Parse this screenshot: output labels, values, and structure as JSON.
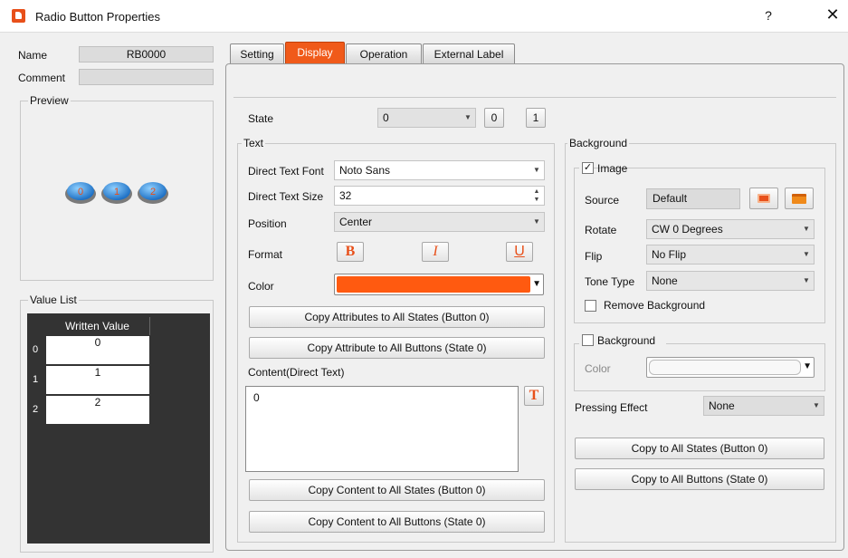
{
  "window": {
    "title": "Radio Button Properties",
    "help": "?",
    "close": "✕"
  },
  "left": {
    "name_label": "Name",
    "name_value": "RB0000",
    "comment_label": "Comment",
    "comment_value": "",
    "preview_label": "Preview",
    "preview_buttons": [
      "0",
      "1",
      "2"
    ],
    "value_list_label": "Value List",
    "table_header": "Written Value",
    "rows": [
      {
        "index": "0",
        "value": "0"
      },
      {
        "index": "1",
        "value": "1"
      },
      {
        "index": "2",
        "value": "2"
      }
    ]
  },
  "tabs": [
    "Setting",
    "Display",
    "Operation",
    "External Label"
  ],
  "active_tab": "Display",
  "display": {
    "state_label": "State",
    "state_value": "0",
    "state_btn0": "0",
    "state_btn1": "1",
    "text_group": "Text",
    "font_label": "Direct Text Font",
    "font_value": "Noto Sans",
    "size_label": "Direct Text Size",
    "size_value": "32",
    "position_label": "Position",
    "position_value": "Center",
    "format_label": "Format",
    "bold": "B",
    "italic": "I",
    "underline": "U",
    "color_label": "Color",
    "color_value": "#ff5a10",
    "copy_attr_states": "Copy Attributes to All States (Button 0)",
    "copy_attr_buttons": "Copy Attribute to All Buttons (State 0)",
    "content_label": "Content(Direct Text)",
    "content_value": "0",
    "text_icon": "T",
    "copy_content_states": "Copy Content to All States (Button 0)",
    "copy_content_buttons": "Copy Content to All Buttons (State 0)",
    "bg_group": "Background",
    "image_label": "Image",
    "image_checked": true,
    "source_label": "Source",
    "source_value": "Default",
    "rotate_label": "Rotate",
    "rotate_value": "CW 0 Degrees",
    "flip_label": "Flip",
    "flip_value": "No Flip",
    "tone_label": "Tone Type",
    "tone_value": "None",
    "remove_bg_label": "Remove Background",
    "background_label": "Background",
    "background_checked": false,
    "bg_color_label": "Color",
    "pressing_label": "Pressing Effect",
    "pressing_value": "None",
    "copy_states": "Copy to All States (Button 0)",
    "copy_buttons": "Copy to All Buttons (State 0)"
  },
  "colors": {
    "accent": "#f05a1a",
    "preview_button": "#1f7fd6"
  }
}
